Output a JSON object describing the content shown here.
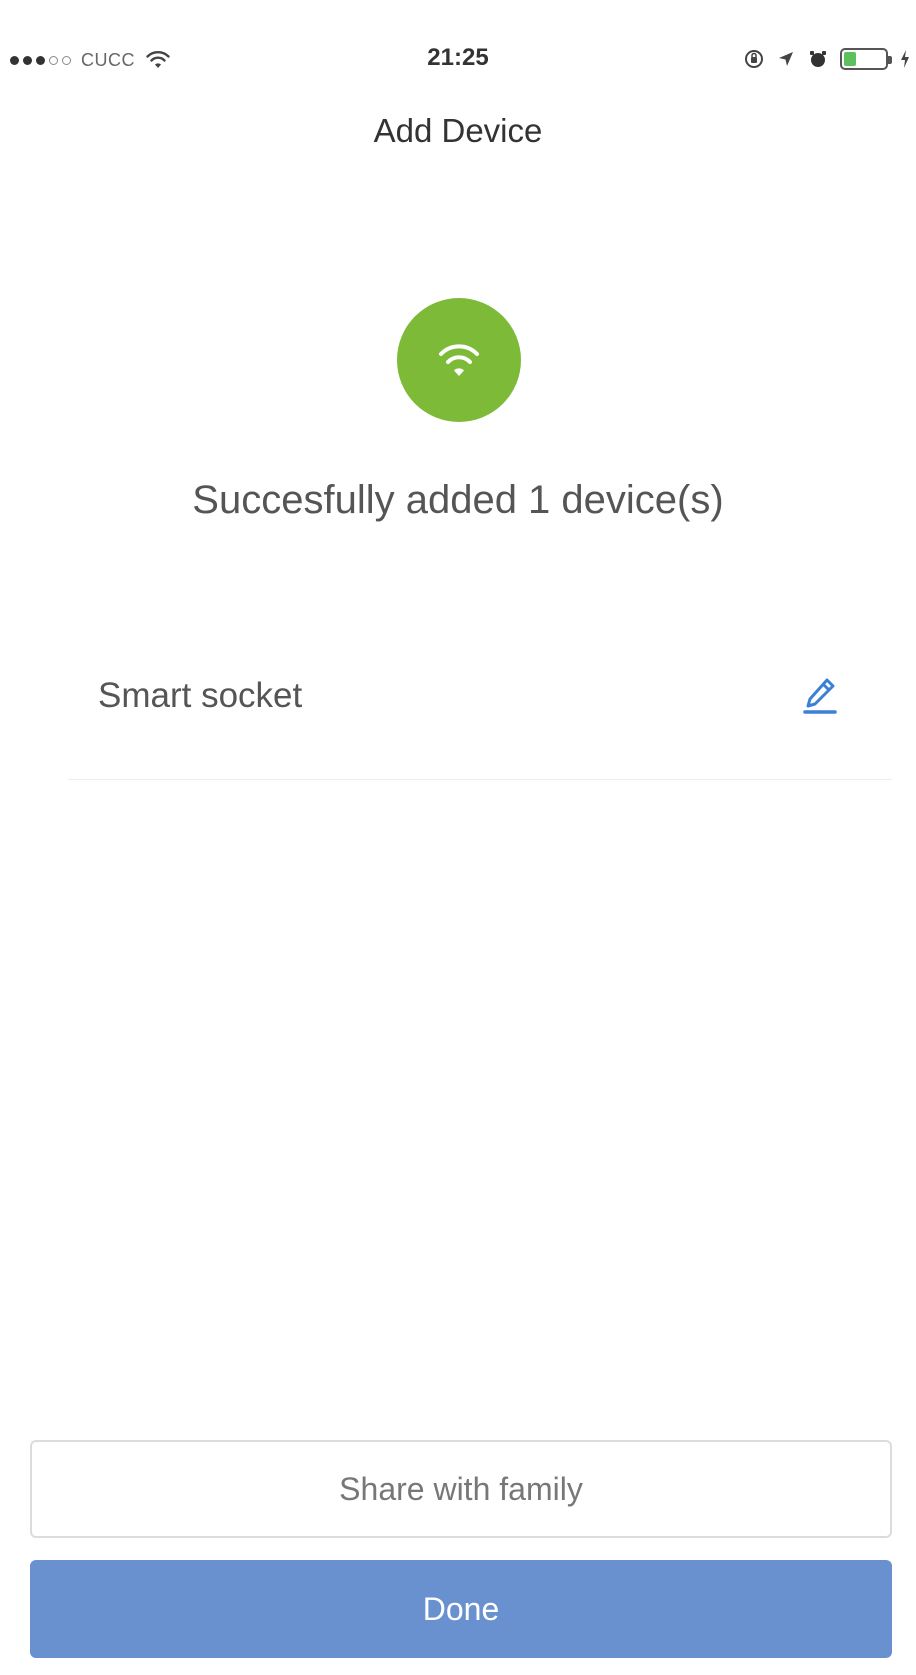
{
  "status_bar": {
    "carrier": "CUCC",
    "time": "21:25",
    "signal_filled": 3,
    "signal_total": 5,
    "battery_level": 0.3,
    "battery_color": "#5cc05c",
    "icons": [
      "wifi-icon",
      "lock-rotation-icon",
      "location-arrow-icon",
      "alarm-icon",
      "battery-icon",
      "charging-bolt-icon"
    ]
  },
  "header": {
    "title": "Add Device"
  },
  "success": {
    "icon": "wifi-icon",
    "icon_bg_color": "#7dba37",
    "message": "Succesfully added 1 device(s)"
  },
  "devices": [
    {
      "name": "Smart socket",
      "action_icon": "edit-pencil-icon",
      "action_color": "#3d7fd6"
    }
  ],
  "actions": {
    "share_label": "Share with family",
    "done_label": "Done",
    "done_color": "#6a91cf"
  }
}
